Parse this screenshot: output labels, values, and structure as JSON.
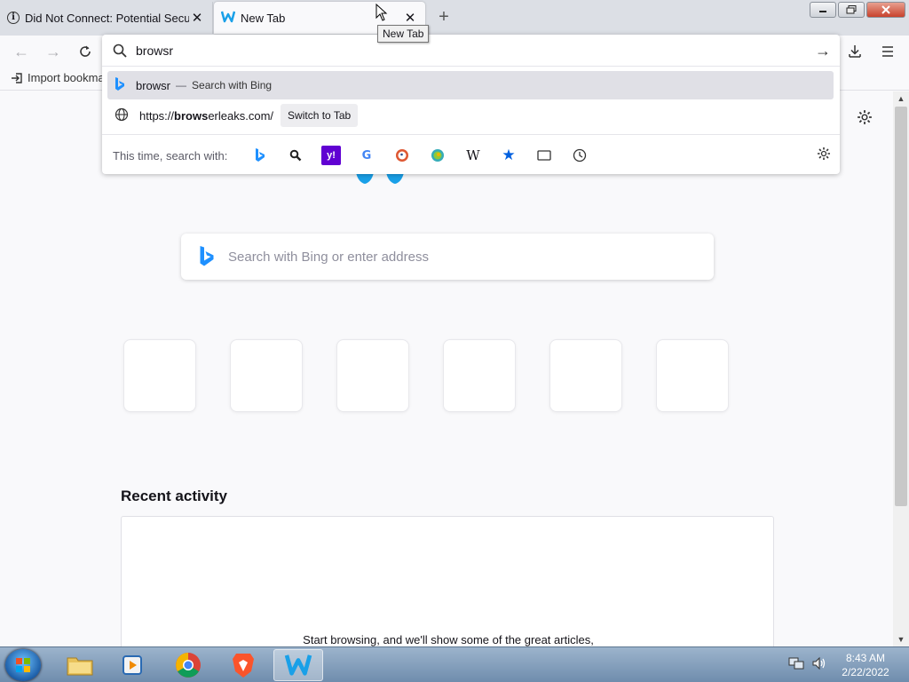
{
  "tabs": [
    {
      "title": "Did Not Connect: Potential Security Issue",
      "icon": "info-icon"
    },
    {
      "title": "New Tab",
      "icon": "browser-logo-icon",
      "active": true
    }
  ],
  "tooltip": "New Tab",
  "window_controls": {
    "minimize": "▭",
    "maximize": "❐",
    "close": "✕"
  },
  "bookmarks": {
    "import_label": "Import bookma"
  },
  "urlbar": {
    "value": "browsr",
    "results": [
      {
        "text": "browsr",
        "separator": "—",
        "action": "Search with Bing",
        "icon": "bing-icon"
      },
      {
        "url_bold": "brows",
        "url_rest": "erleaks.com/",
        "url_prefix": "https://",
        "action": "Switch to Tab",
        "icon": "globe-icon"
      }
    ],
    "oneoff_label": "This time, search with:",
    "engines": [
      "bing",
      "search-tool",
      "yahoo",
      "google",
      "duckduckgo",
      "ecosia",
      "wikipedia",
      "bookmarks",
      "tabs",
      "history"
    ]
  },
  "page": {
    "search_placeholder": "Search with Bing or enter address",
    "tiles_count": 6,
    "recent_title": "Recent activity",
    "recent_empty": "Start browsing, and we'll show some of the great articles,"
  },
  "taskbar": {
    "time": "8:43 AM",
    "date": "2/22/2022"
  },
  "colors": {
    "accent": "#0060df",
    "bing_blue": "#1e90ff"
  }
}
